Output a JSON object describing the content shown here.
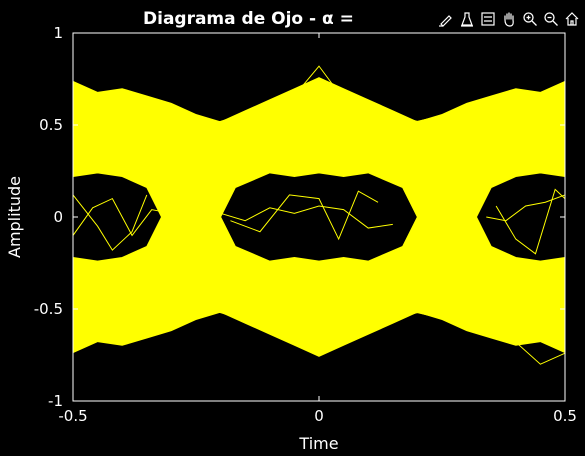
{
  "chart_data": {
    "type": "line",
    "title": "Diagrama de Ojo - α = ",
    "xlabel": "Time",
    "ylabel": "Amplitude",
    "xlim": [
      -0.5,
      0.5
    ],
    "ylim": [
      -1,
      1
    ],
    "xticks": [
      -0.5,
      0,
      0.5
    ],
    "xtick_labels": [
      "-0.5",
      "0",
      "0.5"
    ],
    "yticks": [
      -1,
      -0.5,
      0,
      0.5,
      1
    ],
    "ytick_labels": [
      "-1",
      "-0.5",
      "0",
      "0.5",
      "1"
    ],
    "grid": false,
    "background": "#000000",
    "axis_color": "#ffffff",
    "line_color": "#ffff00",
    "upper_band_top": [
      [
        -0.5,
        0.74
      ],
      [
        -0.45,
        0.68
      ],
      [
        -0.4,
        0.7
      ],
      [
        -0.35,
        0.66
      ],
      [
        -0.3,
        0.62
      ],
      [
        -0.25,
        0.56
      ],
      [
        -0.2,
        0.52
      ],
      [
        -0.15,
        0.58
      ],
      [
        -0.1,
        0.64
      ],
      [
        -0.05,
        0.7
      ],
      [
        0,
        0.76
      ],
      [
        0.05,
        0.7
      ],
      [
        0.1,
        0.64
      ],
      [
        0.15,
        0.58
      ],
      [
        0.2,
        0.52
      ],
      [
        0.25,
        0.56
      ],
      [
        0.3,
        0.62
      ],
      [
        0.35,
        0.66
      ],
      [
        0.4,
        0.7
      ],
      [
        0.45,
        0.68
      ],
      [
        0.5,
        0.74
      ]
    ],
    "eye_inner_top": [
      [
        -0.5,
        0.22
      ],
      [
        -0.45,
        0.24
      ],
      [
        -0.4,
        0.22
      ],
      [
        -0.35,
        0.16
      ],
      [
        -0.32,
        0.0
      ],
      [
        -0.2,
        0.0
      ],
      [
        -0.17,
        0.16
      ],
      [
        -0.1,
        0.24
      ],
      [
        -0.05,
        0.22
      ],
      [
        0,
        0.24
      ],
      [
        0.05,
        0.22
      ],
      [
        0.1,
        0.24
      ],
      [
        0.17,
        0.16
      ],
      [
        0.2,
        0.0
      ],
      [
        0.32,
        0.0
      ],
      [
        0.35,
        0.16
      ],
      [
        0.4,
        0.22
      ],
      [
        0.45,
        0.24
      ],
      [
        0.5,
        0.22
      ]
    ],
    "traces": [
      {
        "x": [
          -0.5,
          -0.45,
          -0.4,
          -0.35,
          -0.3,
          -0.25,
          -0.2,
          -0.15,
          -0.1,
          -0.05,
          0,
          0.05,
          0.1,
          0.15,
          0.2,
          0.25,
          0.3,
          0.35,
          0.4,
          0.45,
          0.5
        ],
        "y": [
          0.72,
          0.6,
          0.65,
          0.58,
          0.55,
          0.5,
          0.52,
          0.56,
          0.6,
          0.66,
          0.82,
          0.64,
          0.6,
          0.55,
          0.52,
          0.55,
          0.58,
          0.62,
          0.66,
          0.6,
          0.7
        ]
      },
      {
        "x": [
          -0.5,
          -0.45,
          -0.4,
          -0.35,
          -0.3,
          -0.25,
          -0.2,
          -0.15,
          -0.1,
          -0.05,
          0,
          0.05,
          0.1,
          0.15,
          0.2,
          0.25,
          0.3,
          0.35,
          0.4,
          0.45,
          0.5
        ],
        "y": [
          -0.72,
          -0.6,
          -0.66,
          -0.58,
          -0.55,
          -0.5,
          -0.52,
          -0.56,
          -0.62,
          -0.66,
          -0.74,
          -0.64,
          -0.6,
          -0.55,
          -0.52,
          -0.55,
          -0.58,
          -0.62,
          -0.68,
          -0.8,
          -0.74
        ]
      },
      {
        "x": [
          -0.5,
          -0.46,
          -0.42,
          -0.38,
          -0.34,
          -0.3
        ],
        "y": [
          -0.1,
          0.05,
          0.1,
          -0.1,
          0.04,
          0.02
        ]
      },
      {
        "x": [
          -0.5,
          -0.45,
          -0.42,
          -0.38,
          -0.35
        ],
        "y": [
          0.12,
          -0.05,
          -0.18,
          -0.08,
          0.12
        ]
      },
      {
        "x": [
          -0.2,
          -0.15,
          -0.1,
          -0.05,
          0,
          0.05,
          0.1,
          0.15
        ],
        "y": [
          0.02,
          -0.02,
          0.05,
          0.02,
          0.06,
          0.04,
          -0.06,
          -0.04
        ]
      },
      {
        "x": [
          -0.18,
          -0.12,
          -0.06,
          0,
          0.04,
          0.08,
          0.12
        ],
        "y": [
          -0.02,
          -0.08,
          0.12,
          0.1,
          -0.12,
          0.14,
          0.08
        ]
      },
      {
        "x": [
          0.34,
          0.38,
          0.42,
          0.46,
          0.5
        ],
        "y": [
          0.0,
          -0.02,
          0.06,
          0.08,
          0.12
        ]
      },
      {
        "x": [
          0.36,
          0.4,
          0.44,
          0.48,
          0.5
        ],
        "y": [
          0.06,
          -0.12,
          -0.2,
          0.15,
          0.1
        ]
      }
    ]
  },
  "toolbar": {
    "items": [
      {
        "name": "brush-icon",
        "glyph": "✎"
      },
      {
        "name": "data-tips-icon",
        "glyph": "⚗"
      },
      {
        "name": "legend-icon",
        "glyph": "☰"
      },
      {
        "name": "pan-icon",
        "glyph": "✋"
      },
      {
        "name": "zoom-in-icon",
        "glyph": "+"
      },
      {
        "name": "zoom-out-icon",
        "glyph": "−"
      },
      {
        "name": "home-icon",
        "glyph": "⌂"
      }
    ]
  }
}
